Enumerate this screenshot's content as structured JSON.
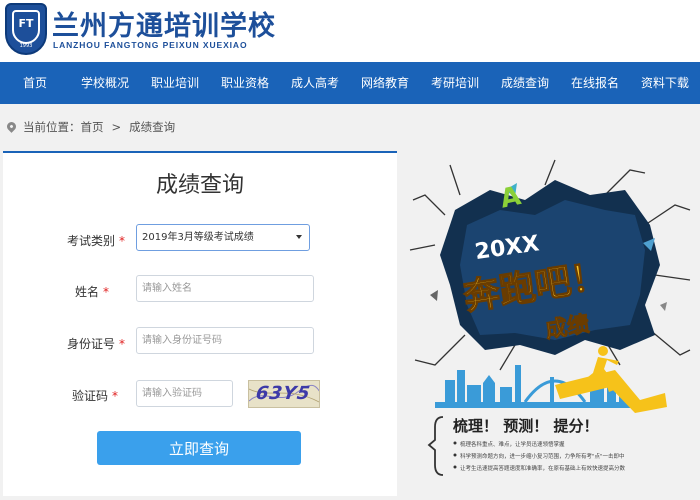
{
  "header": {
    "logo_text": "FT",
    "logo_year": "1993",
    "brand_cn": "兰州方通培训学校",
    "brand_en": "LANZHOU FANGTONG PEIXUN XUEXIAO"
  },
  "nav": [
    "首页",
    "学校概况",
    "职业培训",
    "职业资格",
    "成人高考",
    "网络教育",
    "考研培训",
    "成绩查询",
    "在线报名",
    "资料下载"
  ],
  "breadcrumb": {
    "prefix": "当前位置：",
    "home": "首页",
    "separator": ">",
    "current": "成绩查询"
  },
  "form": {
    "title": "成绩查询",
    "exam_type": {
      "label": "考试类别",
      "required_mark": "*",
      "value": "2019年3月等级考试成绩"
    },
    "name": {
      "label": "姓名",
      "required_mark": "*",
      "placeholder": "请输入姓名"
    },
    "id_number": {
      "label": "身份证号",
      "required_mark": "*",
      "placeholder": "请输入身份证号码"
    },
    "captcha": {
      "label": "验证码",
      "required_mark": "*",
      "placeholder": "请输入验证码",
      "image_text": "63Y5"
    },
    "submit_label": "立即查询"
  },
  "promo": {
    "year": "20XX",
    "slogan_main": "奔跑吧！",
    "slogan_sub": "成绩",
    "tagline": "梳理！ 预测！ 提分！",
    "bullets": [
      "梳理各科重点、难点，让学员迅速领悟掌握",
      "科学预测命题方向，进一步缩小复习范围，力争所有考\"点\"一击即中",
      "让考生迅速提高答题速度和准确率，在原有基础上有效快速提高分数"
    ]
  }
}
